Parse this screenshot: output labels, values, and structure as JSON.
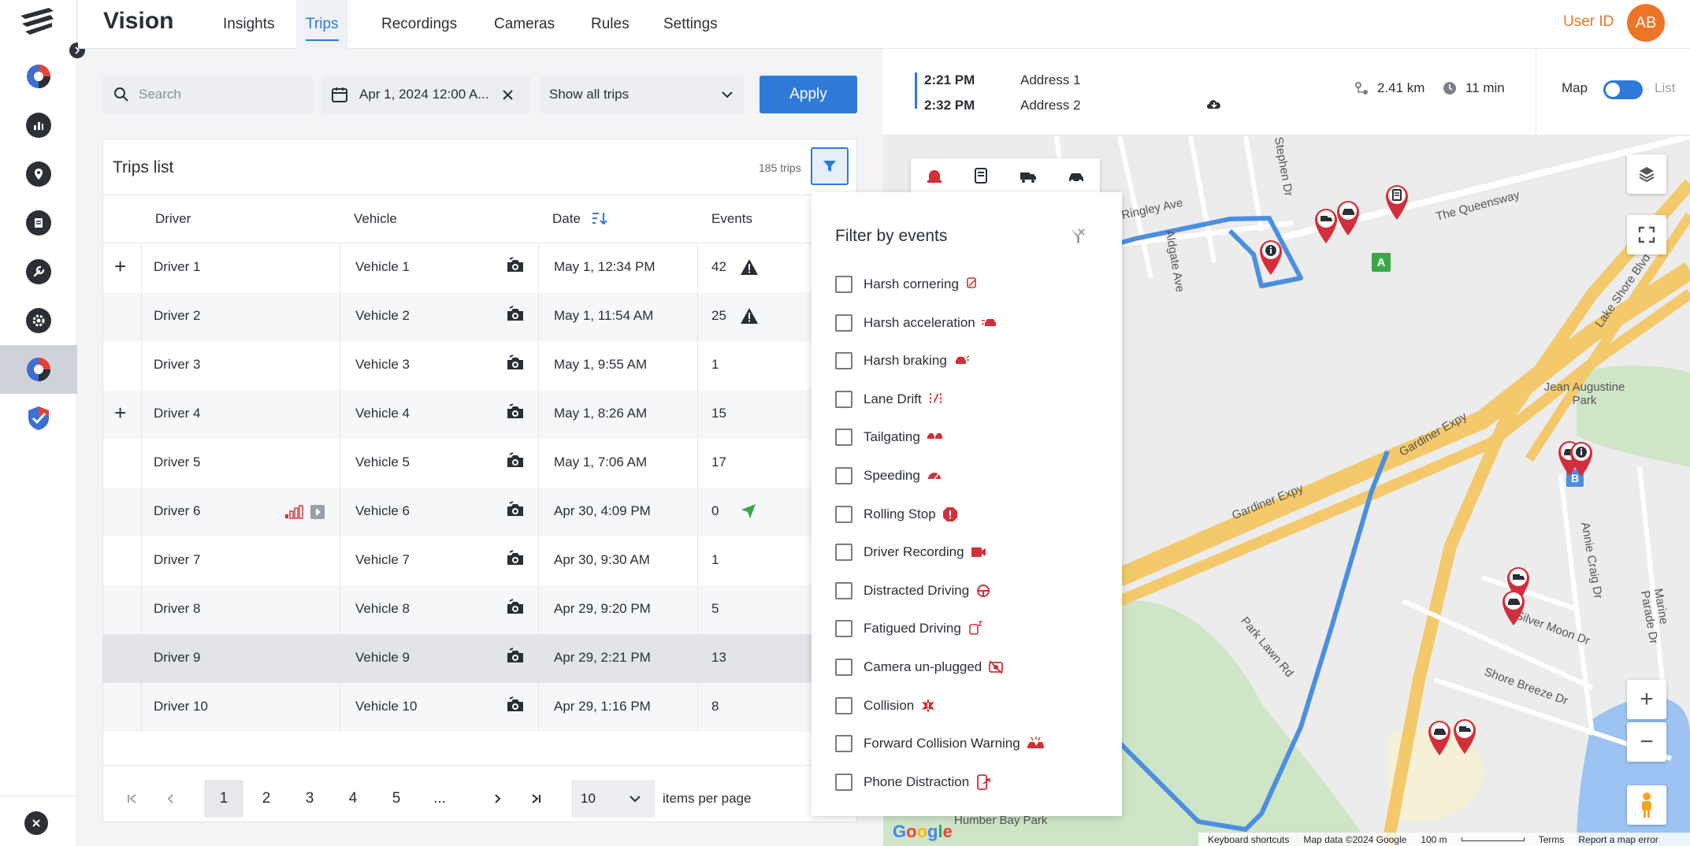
{
  "app": {
    "brand": "Vision",
    "user_id": "User ID",
    "avatar_initials": "AB"
  },
  "nav": {
    "tabs": [
      "Insights",
      "Trips",
      "Recordings",
      "Cameras",
      "Rules",
      "Settings"
    ],
    "active": "Trips"
  },
  "filters": {
    "search_placeholder": "Search",
    "date_value": "Apr 1, 2024 12:00 A...",
    "trip_filter": "Show all trips",
    "apply_label": "Apply"
  },
  "trips": {
    "title": "Trips list",
    "count": "185 trips",
    "columns": {
      "driver": "Driver",
      "vehicle": "Vehicle",
      "date": "Date",
      "events": "Events"
    },
    "rows": [
      {
        "driver": "Driver 1",
        "vehicle": "Vehicle 1",
        "date": "May 1, 12:34 PM",
        "events": "42",
        "expandable": true,
        "event_icon": "warning-icon"
      },
      {
        "driver": "Driver 2",
        "vehicle": "Vehicle 2",
        "date": "May 1, 11:54 AM",
        "events": "25",
        "expandable": false,
        "event_icon": "warning-icon"
      },
      {
        "driver": "Driver 3",
        "vehicle": "Vehicle 3",
        "date": "May 1, 9:55 AM",
        "events": "1",
        "expandable": false,
        "event_icon": ""
      },
      {
        "driver": "Driver 4",
        "vehicle": "Vehicle 4",
        "date": "May 1, 8:26 AM",
        "events": "15",
        "expandable": true,
        "event_icon": ""
      },
      {
        "driver": "Driver 5",
        "vehicle": "Vehicle 5",
        "date": "May 1, 7:06 AM",
        "events": "17",
        "expandable": false,
        "event_icon": ""
      },
      {
        "driver": "Driver 6",
        "vehicle": "Vehicle 6",
        "date": "Apr 30, 4:09 PM",
        "events": "0",
        "expandable": false,
        "event_icon": "navigation-arrow-icon",
        "driver_icons": [
          "signal-bars-icon",
          "play-icon"
        ]
      },
      {
        "driver": "Driver 7",
        "vehicle": "Vehicle 7",
        "date": "Apr 30, 9:30 AM",
        "events": "1",
        "expandable": false,
        "event_icon": ""
      },
      {
        "driver": "Driver 8",
        "vehicle": "Vehicle 8",
        "date": "Apr 29, 9:20 PM",
        "events": "5",
        "expandable": false,
        "event_icon": ""
      },
      {
        "driver": "Driver 9",
        "vehicle": "Vehicle 9",
        "date": "Apr 29, 2:21 PM",
        "events": "13",
        "expandable": false,
        "event_icon": "",
        "selected": true
      },
      {
        "driver": "Driver 10",
        "vehicle": "Vehicle 10",
        "date": "Apr 29, 1:16 PM",
        "events": "8",
        "expandable": false,
        "event_icon": ""
      }
    ]
  },
  "pagination": {
    "pages": [
      "1",
      "2",
      "3",
      "4",
      "5",
      "..."
    ],
    "current": "1",
    "per_page": "10",
    "per_page_label": "items per page"
  },
  "event_filter": {
    "title": "Filter by events",
    "items": [
      "Harsh cornering",
      "Harsh acceleration",
      "Harsh braking",
      "Lane Drift",
      "Tailgating",
      "Speeding",
      "Rolling Stop",
      "Driver Recording",
      "Distracted Driving",
      "Fatigued Driving",
      "Camera un-plugged",
      "Collision",
      "Forward Collision Warning",
      "Phone Distraction"
    ]
  },
  "trip_summary": {
    "start_time": "2:21 PM",
    "start_address": "Address 1",
    "end_time": "2:32 PM",
    "end_address": "Address 2",
    "distance": "2.41 km",
    "duration": "11 min"
  },
  "view_toggle": {
    "map": "Map",
    "list": "List",
    "selected": "Map"
  },
  "map": {
    "street_labels": [
      "Ringley Ave",
      "Stephen Dr",
      "The Queensway",
      "Aldgate Ave",
      "Gardiner Expy",
      "Gardiner Expy",
      "Jean Augustine Park",
      "Lake Shore Blvd W",
      "Annie Craig Dr",
      "Silver Moon Dr",
      "Shore Breeze Dr",
      "Marine Parade Dr",
      "Park Lawn Rd",
      "Humber Bay Park"
    ],
    "attribution": [
      "Keyboard shortcuts",
      "Map data ©2024 Google",
      "100 m",
      "Terms",
      "Report a map error"
    ],
    "route_color": "#4a8fe0",
    "pin_color": "#d32f3b",
    "start_marker": "A",
    "end_marker": "B",
    "zoom_in": "+",
    "zoom_out": "−"
  },
  "colors": {
    "accent": "#2f7ad9",
    "user": "#e8782a",
    "danger": "#d32f3b",
    "ok": "#3aa845"
  }
}
